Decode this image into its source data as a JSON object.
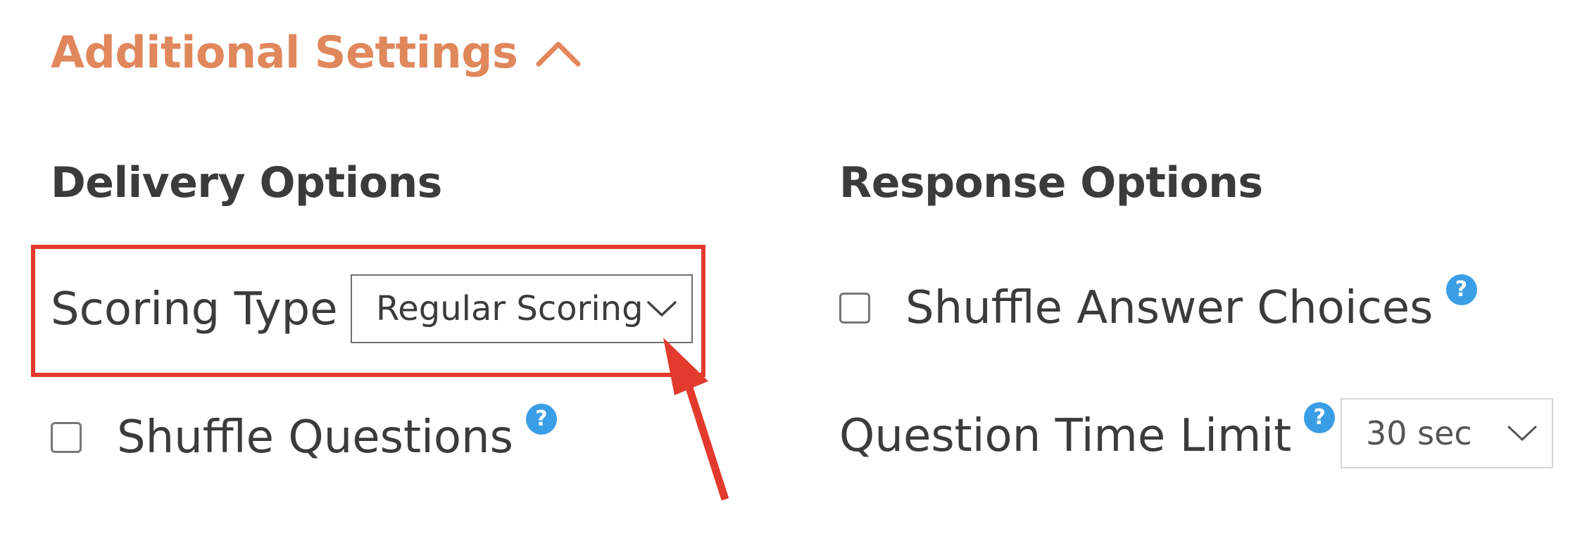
{
  "section": {
    "title": "Additional Settings",
    "toggle_icon": "chevron-up-icon",
    "accent_color": "#e0875c"
  },
  "delivery": {
    "heading": "Delivery Options",
    "scoring_type": {
      "label": "Scoring Type",
      "selected": "Regular Scoring"
    },
    "shuffle_questions": {
      "label": "Shuffle Questions",
      "checked": false,
      "help_icon": "?"
    }
  },
  "response": {
    "heading": "Response Options",
    "shuffle_answers": {
      "label": "Shuffle Answer Choices",
      "checked": false,
      "help_icon": "?"
    },
    "time_limit": {
      "label": "Question Time Limit",
      "help_icon": "?",
      "selected": "30 sec"
    }
  },
  "annotation": {
    "highlight_color": "#e23a2d",
    "target": "scoring-type-select"
  }
}
